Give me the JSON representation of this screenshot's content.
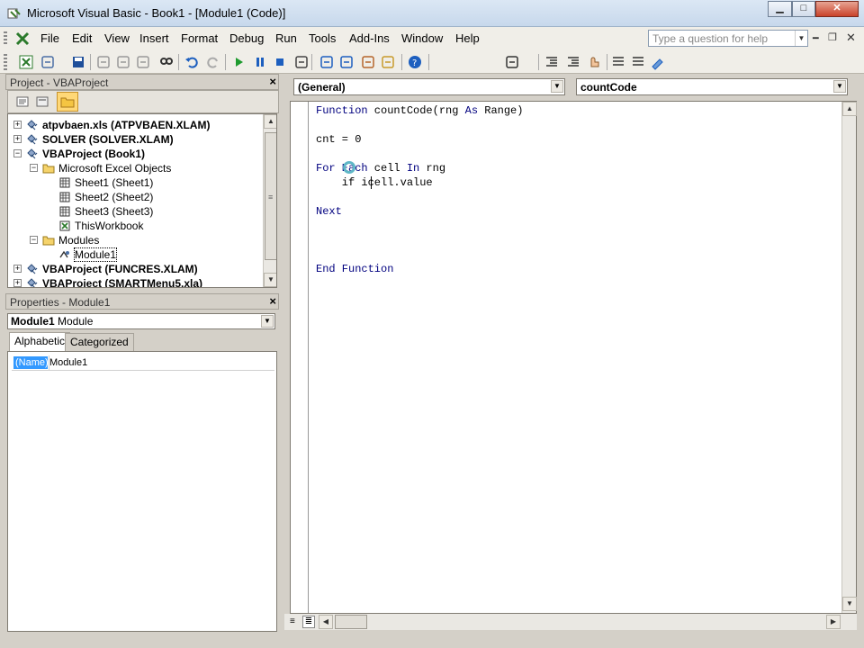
{
  "window": {
    "title": "Microsoft Visual Basic - Book1 - [Module1 (Code)]",
    "controls": [
      "minimize",
      "maximize",
      "close"
    ]
  },
  "menu": {
    "items": [
      "File",
      "Edit",
      "View",
      "Insert",
      "Format",
      "Debug",
      "Run",
      "Tools",
      "Add-Ins",
      "Window",
      "Help"
    ],
    "help_placeholder": "Type a question for help"
  },
  "toolbar": {
    "icons": [
      "view-excel-icon",
      "insert-userform-icon",
      "save-icon",
      "cut-icon",
      "copy-icon",
      "paste-icon",
      "find-icon",
      "undo-icon",
      "redo-icon",
      "run-icon",
      "break-icon",
      "reset-icon",
      "design-mode-icon",
      "project-explorer-icon",
      "properties-icon",
      "object-browser-icon",
      "toolbox-icon",
      "help-icon",
      "list-properties-icon",
      "indent-icon",
      "outdent-icon",
      "toggle-breakpoint-icon",
      "comment-icon",
      "uncomment-icon",
      "bookmark-icon"
    ]
  },
  "project": {
    "title": "Project - VBAProject",
    "close": "×",
    "tree": [
      {
        "label": "atpvbaen.xls (ATPVBAEN.XLAM)",
        "bold": true,
        "level": 0,
        "expander": "+",
        "icon": "vba-project-icon"
      },
      {
        "label": "SOLVER (SOLVER.XLAM)",
        "bold": true,
        "level": 0,
        "expander": "+",
        "icon": "vba-project-icon"
      },
      {
        "label": "VBAProject (Book1)",
        "bold": true,
        "level": 0,
        "expander": "−",
        "icon": "vba-project-icon"
      },
      {
        "label": "Microsoft Excel Objects",
        "bold": false,
        "level": 1,
        "expander": "−",
        "icon": "folder-icon"
      },
      {
        "label": "Sheet1 (Sheet1)",
        "bold": false,
        "level": 2,
        "expander": "",
        "icon": "sheet-icon"
      },
      {
        "label": "Sheet2 (Sheet2)",
        "bold": false,
        "level": 2,
        "expander": "",
        "icon": "sheet-icon"
      },
      {
        "label": "Sheet3 (Sheet3)",
        "bold": false,
        "level": 2,
        "expander": "",
        "icon": "sheet-icon"
      },
      {
        "label": "ThisWorkbook",
        "bold": false,
        "level": 2,
        "expander": "",
        "icon": "workbook-icon"
      },
      {
        "label": "Modules",
        "bold": false,
        "level": 1,
        "expander": "−",
        "icon": "folder-icon"
      },
      {
        "label": "Module1",
        "bold": false,
        "level": 2,
        "expander": "",
        "icon": "module-icon",
        "selected": true
      },
      {
        "label": "VBAProject (FUNCRES.XLAM)",
        "bold": true,
        "level": 0,
        "expander": "+",
        "icon": "vba-project-icon"
      },
      {
        "label": "VBAProject (SMARTMenu5.xla)",
        "bold": true,
        "level": 0,
        "expander": "+",
        "icon": "vba-project-icon"
      }
    ]
  },
  "properties": {
    "title": "Properties - Module1",
    "close": "×",
    "object_name": "Module1",
    "object_type": "Module",
    "tabs": [
      "Alphabetic",
      "Categorized"
    ],
    "rows": [
      {
        "name": "(Name)",
        "value": "Module1"
      }
    ]
  },
  "code": {
    "object_combo": "(General)",
    "procedure_combo": "countCode",
    "lines": [
      [
        {
          "t": "Function",
          "k": true
        },
        {
          "t": " countCode(rng ",
          "k": false
        },
        {
          "t": "As",
          "k": true
        },
        {
          "t": " Range)",
          "k": false
        }
      ],
      [],
      [
        {
          "t": "cnt = 0",
          "k": false
        }
      ],
      [],
      [
        {
          "t": "For Each",
          "k": true
        },
        {
          "t": " cell ",
          "k": false
        },
        {
          "t": "In",
          "k": true
        },
        {
          "t": " rng",
          "k": false
        }
      ],
      [
        {
          "t": "    if icell.value",
          "k": false
        }
      ],
      [],
      [
        {
          "t": "Next",
          "k": true
        }
      ],
      [],
      [],
      [],
      [
        {
          "t": "End Function",
          "k": true
        }
      ]
    ]
  }
}
